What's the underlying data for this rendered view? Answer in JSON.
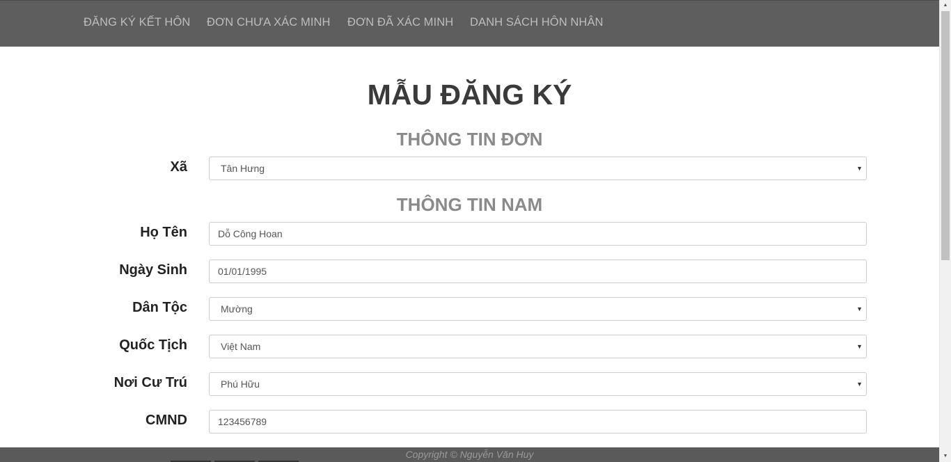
{
  "nav": {
    "items": [
      {
        "label": "ĐĂNG KÝ KẾT HÔN"
      },
      {
        "label": "ĐƠN CHƯA XÁC MINH"
      },
      {
        "label": "ĐƠN ĐÃ XÁC MINH"
      },
      {
        "label": "DANH SÁCH HÔN NHÂN"
      }
    ]
  },
  "page": {
    "title": "MẪU ĐĂNG KÝ"
  },
  "sections": {
    "application_info": "THÔNG TIN ĐƠN",
    "male_info": "THÔNG TIN NAM"
  },
  "form": {
    "commune": {
      "label": "Xã",
      "value": "Tân Hưng"
    },
    "full_name": {
      "label": "Họ Tên",
      "value": "Dỗ Công Hoan"
    },
    "birth_date": {
      "label": "Ngày Sinh",
      "value": "01/01/1995"
    },
    "ethnicity": {
      "label": "Dân Tộc",
      "value": "Mường"
    },
    "nationality": {
      "label": "Quốc Tịch",
      "value": "Việt Nam"
    },
    "residence": {
      "label": "Nơi Cư Trú",
      "value": "Phú Hữu"
    },
    "id_number": {
      "label": "CMND",
      "value": "123456789"
    }
  },
  "footer": {
    "copyright": "Copyright © Nguyễn Văn Huy"
  },
  "colors": {
    "navbar_bg": "#5e5e5e",
    "nav_text": "#bdbdbd",
    "title_text": "#3a3a3a",
    "section_text": "#8a8a8a",
    "footer_bg": "#5a5a5a"
  }
}
